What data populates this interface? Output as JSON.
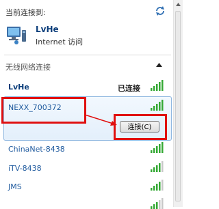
{
  "header": {
    "title": "当前连接到:",
    "connection_name": "LvHe",
    "connection_status": "Internet 访问"
  },
  "section": {
    "title": "无线网络连接"
  },
  "networks": [
    {
      "name": "LvHe",
      "status": "已连接",
      "signal_bars": 5,
      "state": "connected"
    },
    {
      "name": "NEXX_700372",
      "signal_bars": 5,
      "state": "selected",
      "button_label": "连接(C)"
    },
    {
      "name": "ChinaNet-8438",
      "signal_bars": 5
    },
    {
      "name": "iTV-8438",
      "signal_bars": 4
    },
    {
      "name": "JMS",
      "signal_bars": 4
    },
    {
      "name": "",
      "signal_bars": 3
    }
  ],
  "colors": {
    "accent_text": "#1f5a9e",
    "signal_green": "#35a935",
    "annotation_red": "#e01010",
    "selected_border": "#8fb7e0"
  },
  "icons": [
    "refresh-icon",
    "network-computer-icon",
    "chevron-up-icon",
    "signal-strength-icon",
    "red-arrow"
  ]
}
